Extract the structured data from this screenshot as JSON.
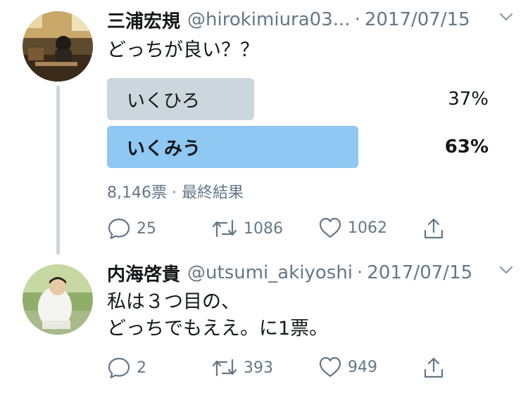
{
  "tweet1": {
    "name": "三浦宏規",
    "handle": "@hirokimiura03...",
    "date": "2017/07/15",
    "text": "どっちが良い？？",
    "poll": {
      "options": [
        {
          "label": "いくひろ",
          "percent_text": "37%",
          "percent": 37,
          "winner": false
        },
        {
          "label": "いくみう",
          "percent_text": "63%",
          "percent": 63,
          "winner": true
        }
      ],
      "meta": "8,146票 · 最終結果"
    },
    "actions": {
      "replies": "25",
      "retweets": "1086",
      "likes": "1062"
    }
  },
  "tweet2": {
    "name": "内海啓貴",
    "handle": "@utsumi_akiyoshi",
    "date": "2017/07/15",
    "text_line1": "私は３つ目の、",
    "text_line2": "どっちでもええ。に1票。",
    "actions": {
      "replies": "2",
      "retweets": "393",
      "likes": "949"
    }
  },
  "separator": "·",
  "colors": {
    "secondary_text": "#657786",
    "poll_winner": "#8ec8f3",
    "poll_loser": "#ccd6dd",
    "thread_line": "#ccd6dd"
  },
  "icons": [
    "reply-icon",
    "retweet-icon",
    "like-icon",
    "share-icon",
    "chevron-down-icon"
  ]
}
